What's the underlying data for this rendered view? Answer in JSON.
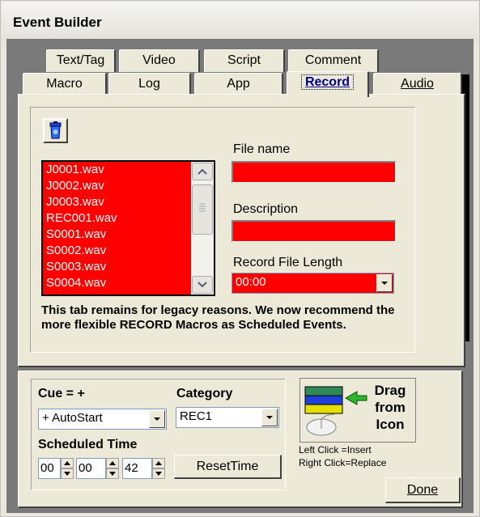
{
  "window": {
    "title": "Event Builder"
  },
  "tabs_row1": [
    "Text/Tag",
    "Video",
    "Script",
    "Comment"
  ],
  "tabs_row2": [
    "Macro",
    "Log",
    "App",
    "Record",
    "Audio"
  ],
  "active_tab": "Record",
  "files": [
    "J0001.wav",
    "J0002.wav",
    "J0003.wav",
    "REC001.wav",
    "S0001.wav",
    "S0002.wav",
    "S0003.wav",
    "S0004.wav"
  ],
  "fields": {
    "file_name_label": "File name",
    "file_name_value": "",
    "description_label": "Description",
    "description_value": "",
    "record_length_label": "Record File Length",
    "record_length_value": "00:00"
  },
  "note": "This tab remains for legacy reasons. We now recommend the more flexible RECORD Macros as Scheduled Events.",
  "lower": {
    "cue_label": "Cue = +",
    "cue_value": "+ AutoStart",
    "category_label": "Category",
    "category_value": "REC1",
    "scheduled_time_label": "Scheduled Time",
    "hours": "00",
    "minutes": "00",
    "seconds": "42",
    "reset_button": "ResetTime",
    "drag_text": "Drag from Icon",
    "left_click_hint": "Left Click  =Insert",
    "right_click_hint": "Right Click=Replace",
    "done_button": "Done"
  },
  "colors": {
    "field_red": "#ff0000",
    "active_tab_text": "#00008b",
    "face": "#ece9d8"
  },
  "icons": [
    "recycle-bin-icon",
    "scroll-up-icon",
    "scroll-down-icon",
    "dropdown-arrow-icon",
    "drag-source-icon"
  ]
}
